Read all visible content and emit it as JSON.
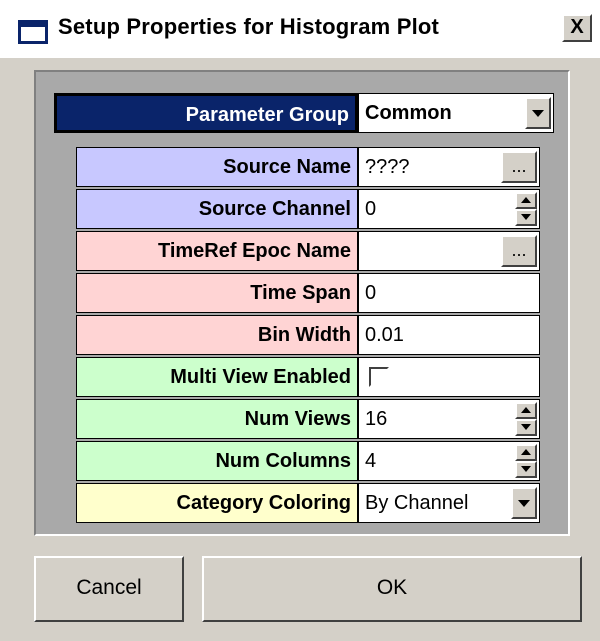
{
  "window": {
    "title": "Setup Properties for Histogram Plot",
    "close_label": "X"
  },
  "parameter_group": {
    "label": "Parameter Group",
    "value": "Common"
  },
  "properties": [
    {
      "label": "Source Name",
      "value": "????",
      "control": "ellipsis",
      "color": "#c8c8ff"
    },
    {
      "label": "Source Channel",
      "value": "0",
      "control": "spinner",
      "color": "#c8c8ff"
    },
    {
      "label": "TimeRef Epoc Name",
      "value": "",
      "control": "ellipsis",
      "color": "#ffd4d4"
    },
    {
      "label": "Time Span",
      "value": "0",
      "control": "text",
      "color": "#ffd4d4"
    },
    {
      "label": "Bin Width",
      "value": "0.01",
      "control": "text",
      "color": "#ffd4d4"
    },
    {
      "label": "Multi View Enabled",
      "value": "",
      "checked": false,
      "control": "checkbox",
      "color": "#ccffcc"
    },
    {
      "label": "Num Views",
      "value": "16",
      "control": "spinner",
      "color": "#ccffcc"
    },
    {
      "label": "Num Columns",
      "value": "4",
      "control": "spinner",
      "color": "#ccffcc"
    },
    {
      "label": "Category Coloring",
      "value": "By Channel",
      "control": "dropdown",
      "color": "#ffffcc"
    }
  ],
  "ellipsis_label": "...",
  "buttons": {
    "cancel": "Cancel",
    "ok": "OK"
  }
}
